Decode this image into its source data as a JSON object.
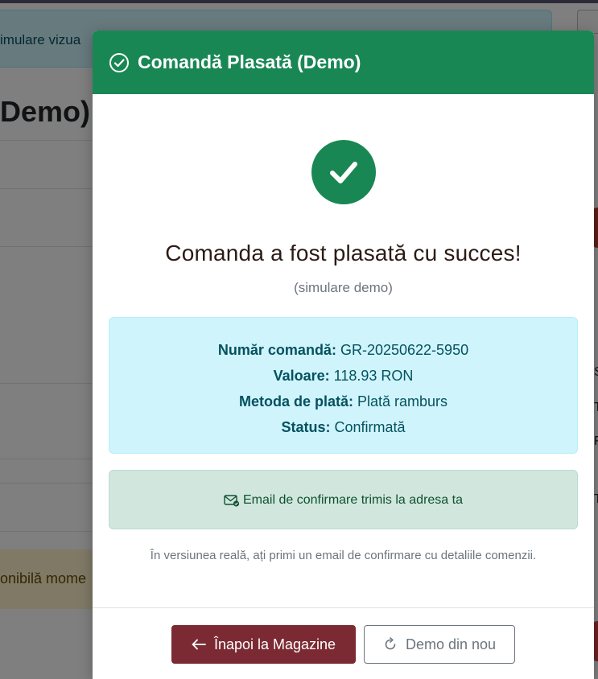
{
  "background": {
    "alert_text": "imulare vizua",
    "page_title": "Demo)",
    "warning_text": "onibilă mome",
    "side_letters": [
      "S",
      "T",
      "F",
      "T"
    ]
  },
  "modal": {
    "title": "Comandă Plasată (Demo)",
    "header_icon": "check-circle-icon",
    "success_icon": "check-icon",
    "headline": "Comanda a fost plasată cu succes!",
    "subtitle": "(simulare demo)",
    "details": [
      {
        "label": "Număr comandă:",
        "value": "GR-20250622-5950"
      },
      {
        "label": "Valoare:",
        "value": "118.93 RON"
      },
      {
        "label": "Metoda de plată:",
        "value": "Plată ramburs"
      },
      {
        "label": "Status:",
        "value": "Confirmată"
      }
    ],
    "email_icon": "envelope-check-icon",
    "email_text": "Email de confirmare trimis la adresa ta",
    "note": "În versiunea reală, ați primi un email de confirmare cu detaliile comenzii.",
    "buttons": {
      "back_label": "Înapoi la Magazine",
      "back_icon": "arrow-left-icon",
      "retry_label": "Demo din nou",
      "retry_icon": "refresh-icon"
    }
  },
  "colors": {
    "success": "#198754",
    "info_bg": "#cff4fc",
    "info_text": "#055160",
    "email_bg": "#d1e7dd",
    "email_text": "#0f5132",
    "primary_button": "#7b2a33"
  }
}
